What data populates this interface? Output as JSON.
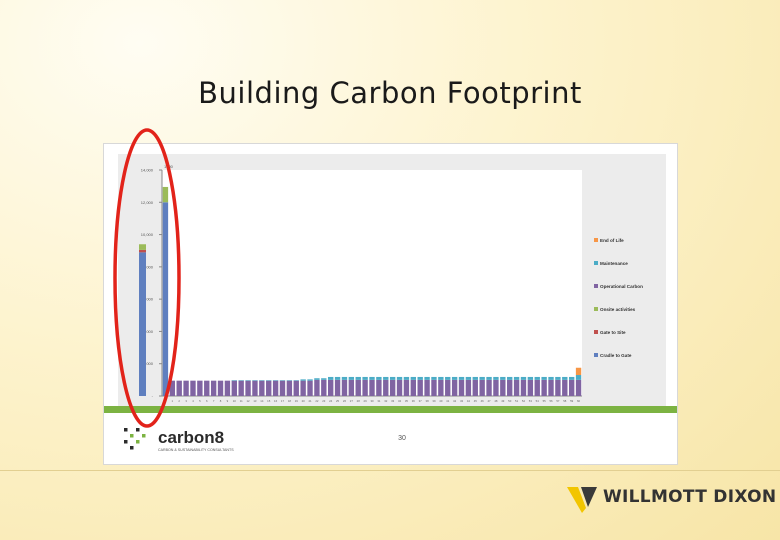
{
  "title": "Building Carbon Footprint",
  "brand": {
    "name": "WILLMOTT DIXON",
    "color": "#f2c500"
  },
  "carbon8": {
    "logo_text": "carbon8",
    "tagline": "CARBON & SUSTAINABILITY CONSULTANTS",
    "accent": "#7cb342"
  },
  "page_number": "30",
  "annotation_color": "#e2231a",
  "chart_data": {
    "type": "bar",
    "stacked": true,
    "title": "",
    "xlabel": "",
    "ylabel": "",
    "ylim": [
      0,
      14000
    ],
    "y_ticks": [
      "-",
      "2,000",
      "4,000",
      "6,000",
      "8,000",
      "10,000",
      "12,000",
      "14,000"
    ],
    "y_tick_values": [
      0,
      2000,
      4000,
      6000,
      8000,
      10000,
      12000,
      14000
    ],
    "y2_tick": "1400",
    "legend_position": "right",
    "legend": [
      "End of Life",
      "Maintenance",
      "Operational Carbon",
      "Onsite activities",
      "Gate to Site",
      "Cradle to Gate"
    ],
    "x_start": 0,
    "x_end": 60,
    "cumulative_bar": {
      "x": 0,
      "values": {
        "Cradle to Gate": 8900,
        "Gate to Site": 150,
        "Onsite activities": 350,
        "Operational Carbon": 0,
        "Maintenance": 0,
        "End of Life": 0
      }
    },
    "series": [
      {
        "name": "Cradle to Gate",
        "color": "#5f7fbf",
        "values": [
          12000,
          0
        ]
      },
      {
        "name": "Gate to Site",
        "color": "#c0504d",
        "values": [
          0,
          0
        ]
      },
      {
        "name": "Onsite activities",
        "color": "#9bbb59",
        "values": [
          950,
          0
        ]
      },
      {
        "name": "Operational Carbon",
        "color": "#8064a2",
        "values": [
          0,
          950,
          950,
          950,
          950,
          950,
          950,
          950,
          950,
          950,
          950,
          950,
          950,
          950,
          950,
          950,
          950,
          950,
          950,
          950,
          950,
          950,
          1000,
          1000,
          1000,
          1000,
          1000,
          1000,
          1000,
          1000,
          1000,
          1000,
          1000,
          1000,
          1000,
          1000,
          1000,
          1000,
          1000,
          1000,
          1000,
          1000,
          1000,
          1000,
          1000,
          1000,
          1000,
          1000,
          1000,
          1000,
          1000,
          1000,
          1000,
          1000,
          1000,
          1000,
          1000,
          1000,
          1000,
          1000,
          1000
        ]
      },
      {
        "name": "Maintenance",
        "color": "#4bacc6",
        "values": [
          0,
          0,
          0,
          0,
          0,
          0,
          0,
          0,
          0,
          0,
          30,
          30,
          30,
          30,
          30,
          30,
          30,
          30,
          30,
          30,
          80,
          80,
          100,
          100,
          180,
          180,
          180,
          180,
          180,
          180,
          180,
          180,
          180,
          180,
          180,
          180,
          180,
          180,
          180,
          180,
          180,
          180,
          180,
          180,
          180,
          180,
          180,
          180,
          180,
          180,
          180,
          180,
          180,
          180,
          180,
          180,
          180,
          180,
          180,
          180,
          300
        ]
      },
      {
        "name": "End of Life",
        "color": "#f79646",
        "values": [
          0,
          0,
          0,
          0,
          0,
          0,
          0,
          0,
          0,
          0,
          0,
          0,
          0,
          0,
          0,
          0,
          0,
          0,
          0,
          0,
          0,
          0,
          0,
          0,
          0,
          0,
          0,
          0,
          0,
          0,
          0,
          0,
          0,
          0,
          0,
          0,
          0,
          0,
          0,
          0,
          0,
          0,
          0,
          0,
          0,
          0,
          0,
          0,
          0,
          0,
          0,
          0,
          0,
          0,
          0,
          0,
          0,
          0,
          0,
          0,
          450
        ]
      }
    ]
  }
}
